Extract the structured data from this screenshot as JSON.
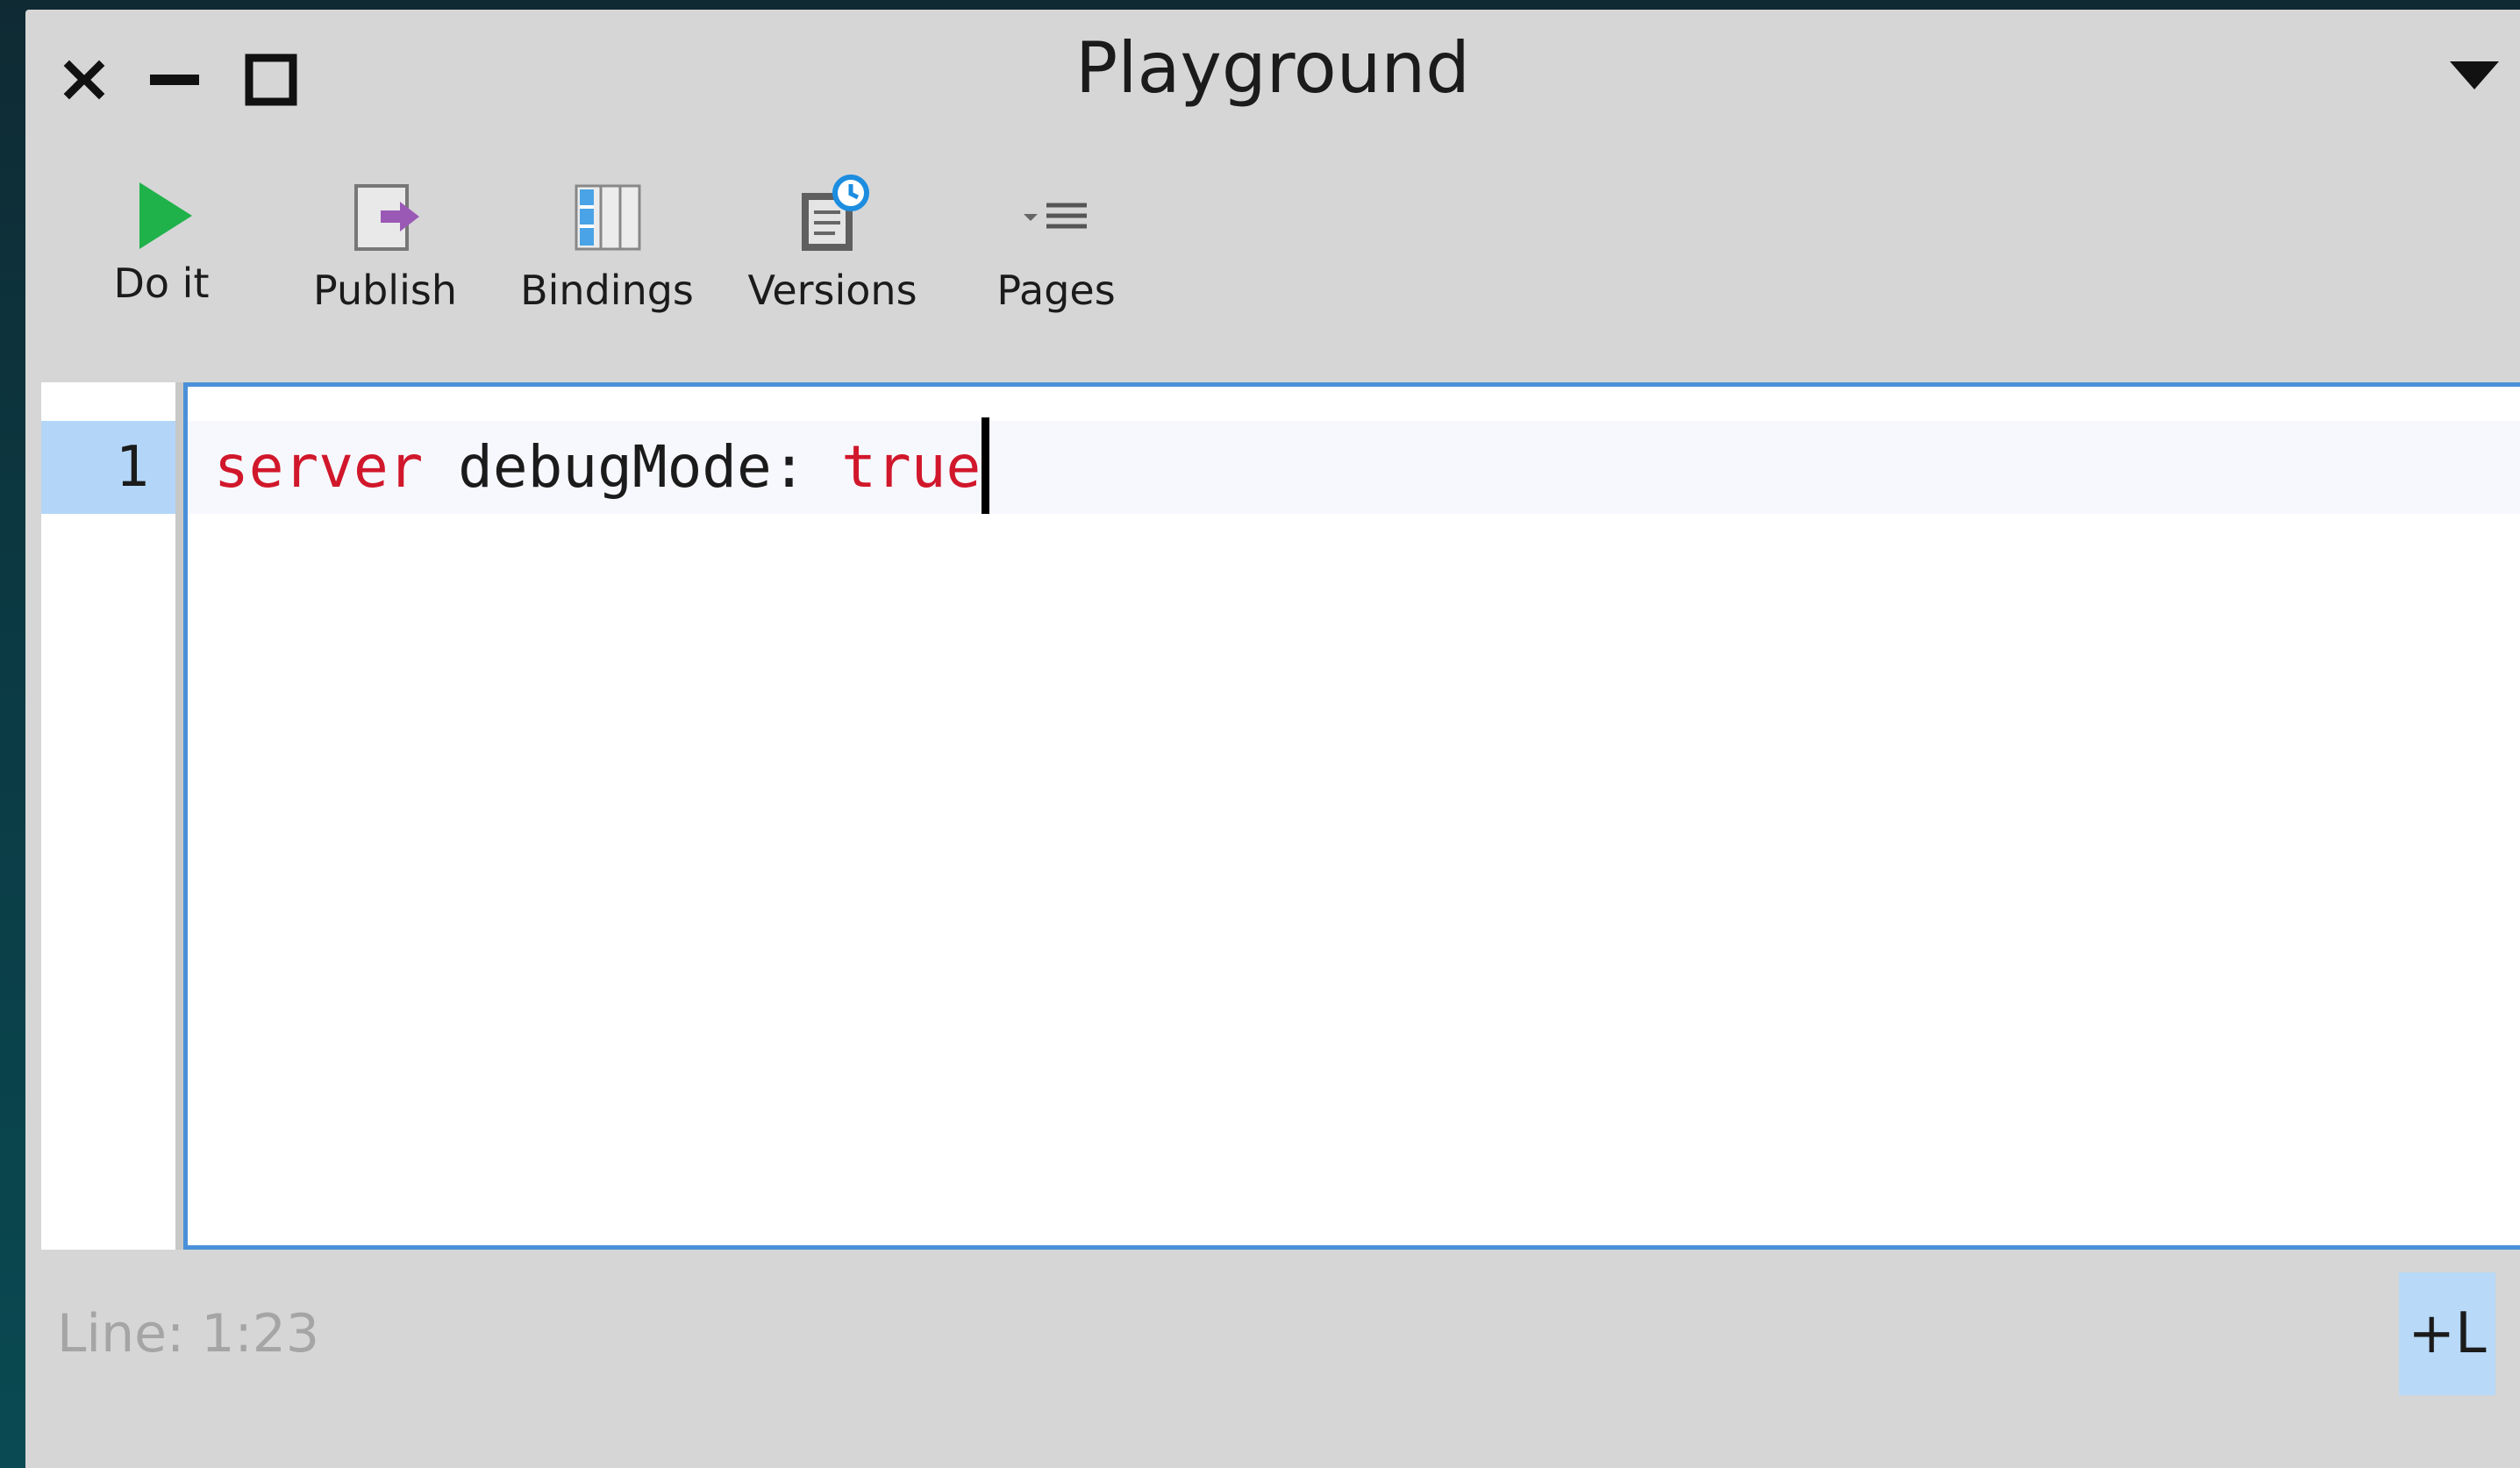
{
  "window": {
    "title": "Playground",
    "controls": [
      "close-icon",
      "minimize-icon",
      "maximize-icon"
    ],
    "menu_icon": "triangle-down-icon"
  },
  "toolbar": {
    "items": [
      {
        "label": "Do it",
        "icon": "play-icon"
      },
      {
        "label": "Publish",
        "icon": "publish-icon"
      },
      {
        "label": "Bindings",
        "icon": "bindings-icon"
      },
      {
        "label": "Versions",
        "icon": "versions-icon"
      },
      {
        "label": "Pages",
        "icon": "pages-icon"
      }
    ]
  },
  "editor": {
    "line_numbers": [
      "1"
    ],
    "lines": [
      {
        "tokens": [
          {
            "text": "server",
            "kind": "keyword"
          },
          {
            "text": " debugMode: ",
            "kind": "plain"
          },
          {
            "text": "true",
            "kind": "keyword"
          }
        ]
      }
    ]
  },
  "status": {
    "position": "Line: 1:23",
    "line_toggle_label": "+L"
  },
  "colors": {
    "keyword": "#d1172b",
    "editor_border": "#4a90d9",
    "current_line_gutter": "#b3d6f8",
    "play_green": "#1fb24a",
    "icon_blue": "#4aa3e6",
    "icon_purple": "#9b59b6"
  }
}
